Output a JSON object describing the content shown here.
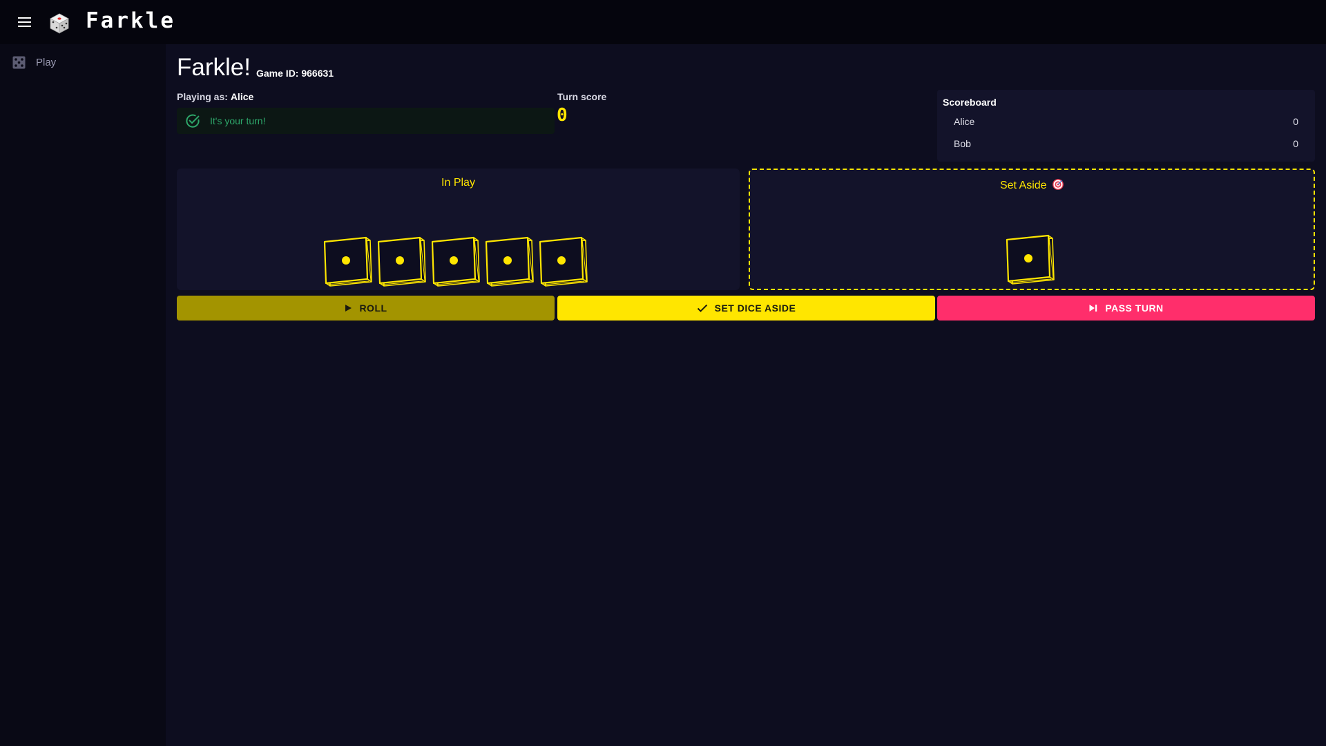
{
  "app": {
    "title": "Farkle",
    "logo_icon": "dice-icon",
    "menu_icon": "hamburger-menu-icon"
  },
  "sidenav": {
    "items": [
      {
        "label": "Play",
        "icon": "dice-grid-icon"
      }
    ]
  },
  "header": {
    "title": "Farkle!",
    "game_id_label": "Game ID:",
    "game_id": "966631",
    "game_id_text": "Game ID: 966631"
  },
  "player": {
    "playing_as_label": "Playing as:",
    "name": "Alice"
  },
  "turn": {
    "alert_text": "It's your turn!",
    "alert_icon": "check-circle-icon",
    "score_label": "Turn score",
    "score_value": "0"
  },
  "scoreboard": {
    "title": "Scoreboard",
    "rows": [
      {
        "name": "Alice",
        "score": "0"
      },
      {
        "name": "Bob",
        "score": "0"
      }
    ]
  },
  "zones": {
    "in_play": {
      "title": "In Play",
      "dice": [
        1,
        1,
        1,
        1,
        1
      ]
    },
    "set_aside": {
      "title": "Set Aside",
      "title_icon": "target-icon",
      "dice": [
        1
      ]
    }
  },
  "buttons": {
    "roll": {
      "label": "ROLL",
      "icon": "play-icon"
    },
    "set_aside": {
      "label": "SET DICE ASIDE",
      "icon": "check-icon"
    },
    "pass_turn": {
      "label": "PASS TURN",
      "icon": "skip-next-icon"
    }
  },
  "colors": {
    "accent_yellow": "#ffe600",
    "roll_button": "#a39400",
    "pass_button": "#ff2e6b",
    "success_green": "#2ea86b",
    "background": "#0d0d1f",
    "panel": "#13132a"
  }
}
